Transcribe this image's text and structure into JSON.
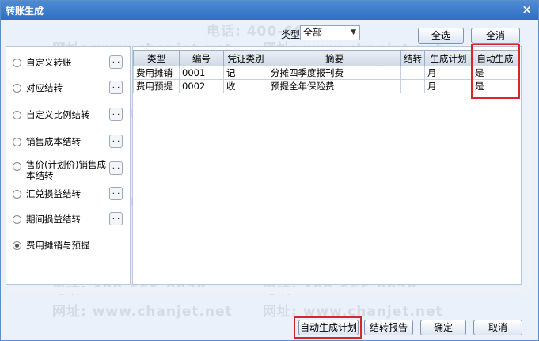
{
  "window": {
    "title": "转账生成",
    "close_glyph": "×"
  },
  "watermark": {
    "phone": "电话: 400-665-0028",
    "site": "网址: www.chanjet.net"
  },
  "filter": {
    "type_label": "类型",
    "type_value": "全部"
  },
  "top_buttons": {
    "select_all": "全选",
    "clear_all": "全消"
  },
  "options": [
    {
      "label": "自定义转账",
      "checked": false
    },
    {
      "label": "对应结转",
      "checked": false
    },
    {
      "label": "自定义比例结转",
      "checked": false
    },
    {
      "label": "销售成本结转",
      "checked": false
    },
    {
      "label": "售价(计划价)销售成本结转",
      "checked": false
    },
    {
      "label": "汇兑损益结转",
      "checked": false
    },
    {
      "label": "期间损益结转",
      "checked": false
    },
    {
      "label": "费用摊销与预提",
      "checked": true
    }
  ],
  "dots_label": "...",
  "table": {
    "headers": [
      "类型",
      "编号",
      "凭证类别",
      "摘要",
      "结转",
      "生成计划",
      "自动生成"
    ],
    "rows": [
      [
        "费用摊销",
        "0001",
        "记",
        "分摊四季度报刊费",
        "",
        "月",
        "是"
      ],
      [
        "费用预提",
        "0002",
        "收",
        "预提全年保险费",
        "",
        "月",
        "是"
      ]
    ]
  },
  "bottom_buttons": {
    "auto_plan": "自动生成计划",
    "report": "结转报告",
    "ok": "确定",
    "cancel": "取消"
  }
}
